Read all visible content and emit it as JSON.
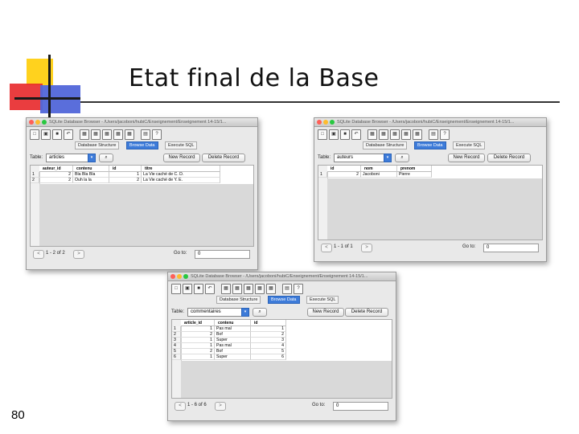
{
  "slide": {
    "title": "Etat final de la Base",
    "page_number": "80"
  },
  "toolbar_icons": [
    "new-file-icon",
    "open-folder-icon",
    "save-icon",
    "undo-icon",
    "create-table-icon",
    "modify-table-icon",
    "delete-table-icon",
    "create-index-icon",
    "delete-index-icon",
    "query-icon",
    "whats-this-icon"
  ],
  "tabs": [
    "Database Structure",
    "Browse Data",
    "Execute SQL"
  ],
  "labels": {
    "table": "Table:",
    "new_record": "New Record",
    "delete_record": "Delete Record",
    "goto": "Go to:",
    "search": "🔍"
  },
  "windows": [
    {
      "title": "SQLite Database Browser - /Users/jacoboni/hubiC/Enseignement/Enseignement 14-15/1...",
      "table_name": "articles",
      "columns": [
        "auteur_id",
        "contenu",
        "id",
        "titre"
      ],
      "rows": [
        [
          "1",
          "2",
          "Bla Bla Bla",
          "1",
          "La Vie caché de C. D."
        ],
        [
          "2",
          "2",
          "Ouh la la",
          "2",
          "La Vie caché de Y. E."
        ]
      ],
      "pager": "1 - 2 of 2",
      "goto_value": "0"
    },
    {
      "title": "SQLite Database Browser - /Users/jacoboni/hubiC/Enseignement/Enseignement 14-15/1...",
      "table_name": "auteurs",
      "columns": [
        "id",
        "nom",
        "prenom"
      ],
      "rows": [
        [
          "1",
          "2",
          "Jacoboni",
          "Pierre"
        ]
      ],
      "pager": "1 - 1 of 1",
      "goto_value": "0"
    },
    {
      "title": "SQLite Database Browser - /Users/jacoboni/hubiC/Enseignement/Enseignement 14-15/1...",
      "table_name": "commentaires",
      "columns": [
        "article_id",
        "contenu",
        "id"
      ],
      "rows": [
        [
          "1",
          "1",
          "Pas mal",
          "1"
        ],
        [
          "2",
          "2",
          "Bof",
          "2"
        ],
        [
          "3",
          "1",
          "Super",
          "3"
        ],
        [
          "4",
          "1",
          "Pas mal",
          "4"
        ],
        [
          "5",
          "2",
          "Bof",
          "5"
        ],
        [
          "6",
          "1",
          "Super",
          "6"
        ]
      ],
      "pager": "1 - 6 of 6",
      "goto_value": "0"
    }
  ]
}
